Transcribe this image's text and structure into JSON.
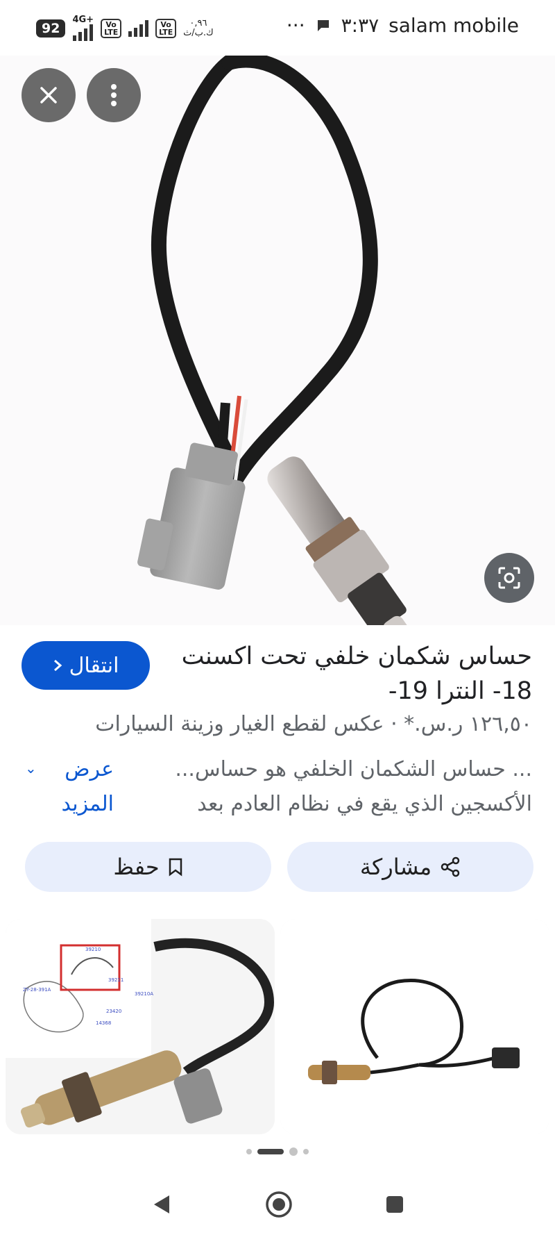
{
  "status_bar": {
    "carrier": "salam mobile",
    "time": "٣:٣٧",
    "more_dots": "···",
    "battery": "92",
    "network": "4G+",
    "volte1": "Vo LTE",
    "volte2": "Vo LTE",
    "speed_value": "٠,٩٦",
    "speed_unit": "ك.ب/ث"
  },
  "result": {
    "title": "حساس شكمان خلفي تحت اكسنت 18- النترا 19-",
    "visit_label": "انتقال",
    "meta": "١٢٦,٥٠ ر.س.* · عكس لقطع الغيار وزينة السيارات",
    "description": "... حساس الشكمان الخلفي هو حساس... الأكسجين الذي يقع في نظام العادم بعد",
    "more_label": "عرض المزيد"
  },
  "actions": {
    "share_label": "مشاركة",
    "save_label": "حفظ"
  },
  "diagram_labels": [
    "39210",
    "39211",
    "39210A",
    "23420",
    "ZY-28-391A",
    "14368"
  ],
  "pagination": {
    "count": 4,
    "active": 1
  },
  "colors": {
    "accent": "#0b57d0",
    "pill_bg": "#e8eefc",
    "circle_btn": "#6a6a6a"
  },
  "icons": [
    "close-icon",
    "more-vert-icon",
    "lens-search-icon",
    "chevron-right-icon",
    "chevron-down-icon",
    "share-icon",
    "bookmark-icon",
    "back-icon",
    "home-icon",
    "recents-icon"
  ]
}
